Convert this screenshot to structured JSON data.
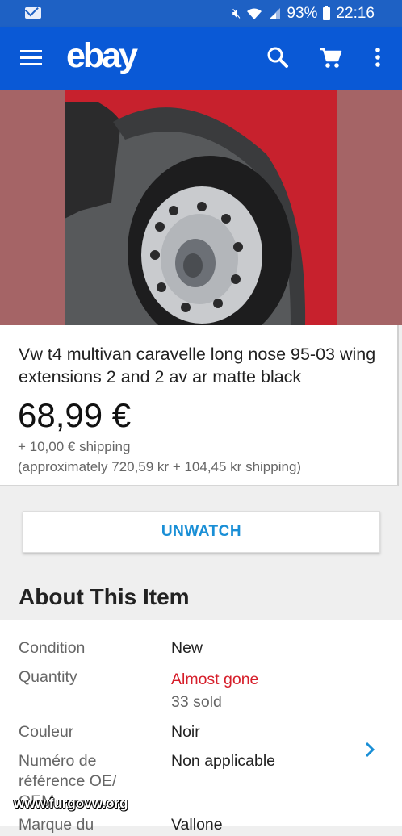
{
  "status_bar": {
    "icons": [
      "mail-icon",
      "mute-icon",
      "wifi-icon",
      "signal-icon",
      "battery-icon"
    ],
    "battery": "93%",
    "time": "22:16"
  },
  "header": {
    "logo": "ebay",
    "icons": [
      "menu-icon",
      "search-icon",
      "cart-icon",
      "more-vert-icon"
    ],
    "color": "#0a59d6"
  },
  "item": {
    "title": "Vw t4 multivan caravelle long nose 95-03 wing extensions 2 and 2 av ar matte black",
    "price": "68,99 €",
    "shipping": "+ 10,00 € shipping",
    "approx": "(approximately 720,59 kr + 104,45 kr shipping)"
  },
  "actions": {
    "unwatch": "UNWATCH"
  },
  "about": {
    "title": "About This Item",
    "rows": [
      {
        "label": "Condition",
        "value": "New"
      },
      {
        "label": "Quantity",
        "value": "Almost gone",
        "extra": "33 sold"
      },
      {
        "label": "Couleur",
        "value": "Noir"
      },
      {
        "label": "Numéro de référence OE/ OEM",
        "value": "Non applicable"
      },
      {
        "label": "Marque du",
        "value": "Vallone"
      }
    ]
  },
  "watermark": "www.furgovw.org",
  "colors": {
    "accent": "#1a8fd6",
    "alert": "#d61e2a",
    "hero_bg": "#a56466"
  }
}
